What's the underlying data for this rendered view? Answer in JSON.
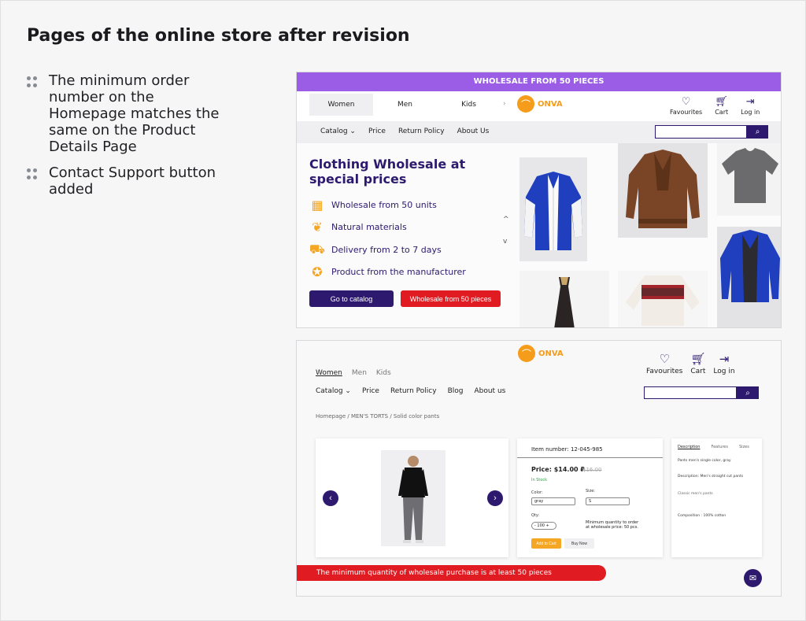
{
  "slide": {
    "title": "Pages of the online store after revision",
    "bullets": [
      "The minimum order number on the Homepage matches the same on the Product Details Page",
      "Contact Support button added"
    ]
  },
  "home": {
    "promo": "WHOLESALE FROM 50 PIECES",
    "tabs": [
      "Women",
      "Men",
      "Kids"
    ],
    "logo": "ONVA",
    "account": [
      "Favourites",
      "Cart",
      "Log in"
    ],
    "nav": [
      "Catalog ⌄",
      "Price",
      "Return Policy",
      "About Us"
    ],
    "hero_title": "Clothing Wholesale at special prices",
    "features": [
      "Wholesale from 50 units",
      "Natural materials",
      "Delivery from 2 to 7 days",
      "Product from the manufacturer"
    ],
    "btn_catalog": "Go to catalog",
    "btn_wholesale": "Wholesale from 50 pieces"
  },
  "pdp": {
    "logo": "ONVA",
    "account": [
      "Favourites",
      "Cart",
      "Log in"
    ],
    "gender": [
      "Women",
      "Men",
      "Kids"
    ],
    "nav": [
      "Catalog ⌄",
      "Price",
      "Return Policy",
      "Blog",
      "About us"
    ],
    "breadcrumb": "Homepage / MEN'S TORTS / Solid color pants",
    "item_number": "Item number: 12-045-985",
    "price": "Price: $14.00 ₽",
    "old_price": "$16.00",
    "stock": "In Stock",
    "color_label": "Color:",
    "color_value": "gray",
    "size_label": "Size:",
    "size_value": "S",
    "qty_label": "Qty:",
    "qty_value": "-   100   +",
    "min_note": "Minimum quantity to order at wholesale price: 50 pcs.",
    "add_to_cart": "Add to Cart",
    "buy_now": "Buy Now",
    "info_tabs": [
      "Description",
      "Features",
      "Sizes"
    ],
    "info_texts": [
      "Pants men's single color, gray",
      "Description: Men's straight cut pants",
      "Classic men's pants",
      "Composition : 100% cotton"
    ],
    "warning": "The minimum quantity of wholesale purchase is at least 50 pieces"
  }
}
